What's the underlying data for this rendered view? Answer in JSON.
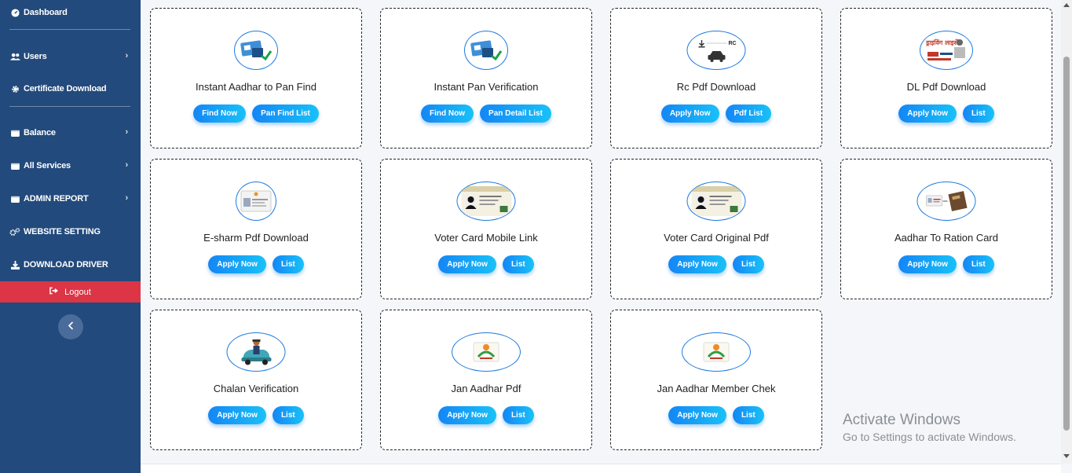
{
  "sidebar": {
    "items": [
      {
        "label": "Dashboard",
        "icon": "dashboard-icon"
      },
      {
        "label": "Users",
        "icon": "users-icon"
      },
      {
        "label": "Certificate Download",
        "icon": "gear-icon"
      },
      {
        "label": "Balance",
        "icon": "wallet-icon"
      },
      {
        "label": "All Services",
        "icon": "wallet-icon"
      },
      {
        "label": "ADMIN REPORT",
        "icon": "wallet-icon"
      },
      {
        "label": "WEBSITE SETTING",
        "icon": "cogs-icon"
      },
      {
        "label": "DOWNLOAD DRIVER",
        "icon": "download-icon"
      }
    ],
    "logout_label": "Logout"
  },
  "services": [
    {
      "title": "Instant Aadhar to Pan Find",
      "buttons": [
        "Find Now",
        "Pan Find List"
      ]
    },
    {
      "title": "Instant Pan Verification",
      "buttons": [
        "Find Now",
        "Pan Detail List"
      ]
    },
    {
      "title": "Rc Pdf Download",
      "buttons": [
        "Apply Now",
        "Pdf List"
      ],
      "logo_text": "RC"
    },
    {
      "title": "DL Pdf Download",
      "buttons": [
        "Apply Now",
        "List"
      ],
      "logo_text": "ड्राइविंग लाइसेंस"
    },
    {
      "title": "E-sharm Pdf Download",
      "buttons": [
        "Apply Now",
        "List"
      ]
    },
    {
      "title": "Voter Card Mobile Link",
      "buttons": [
        "Apply Now",
        "List"
      ]
    },
    {
      "title": "Voter Card Original Pdf",
      "buttons": [
        "Apply Now",
        "List"
      ]
    },
    {
      "title": "Aadhar To Ration Card",
      "buttons": [
        "Apply Now",
        "List"
      ]
    },
    {
      "title": "Chalan Verification",
      "buttons": [
        "Apply Now",
        "List"
      ]
    },
    {
      "title": "Jan Aadhar Pdf",
      "buttons": [
        "Apply Now",
        "List"
      ]
    },
    {
      "title": "Jan Aadhar Member Chek",
      "buttons": [
        "Apply Now",
        "List"
      ]
    }
  ],
  "watermark": {
    "line1": "Activate Windows",
    "line2": "Go to Settings to activate Windows."
  },
  "colors": {
    "sidebar_bg": "#224a7c",
    "logout_bg": "#dc3545",
    "button_gradient_start": "#1486f5",
    "button_gradient_end": "#19c1f7"
  }
}
